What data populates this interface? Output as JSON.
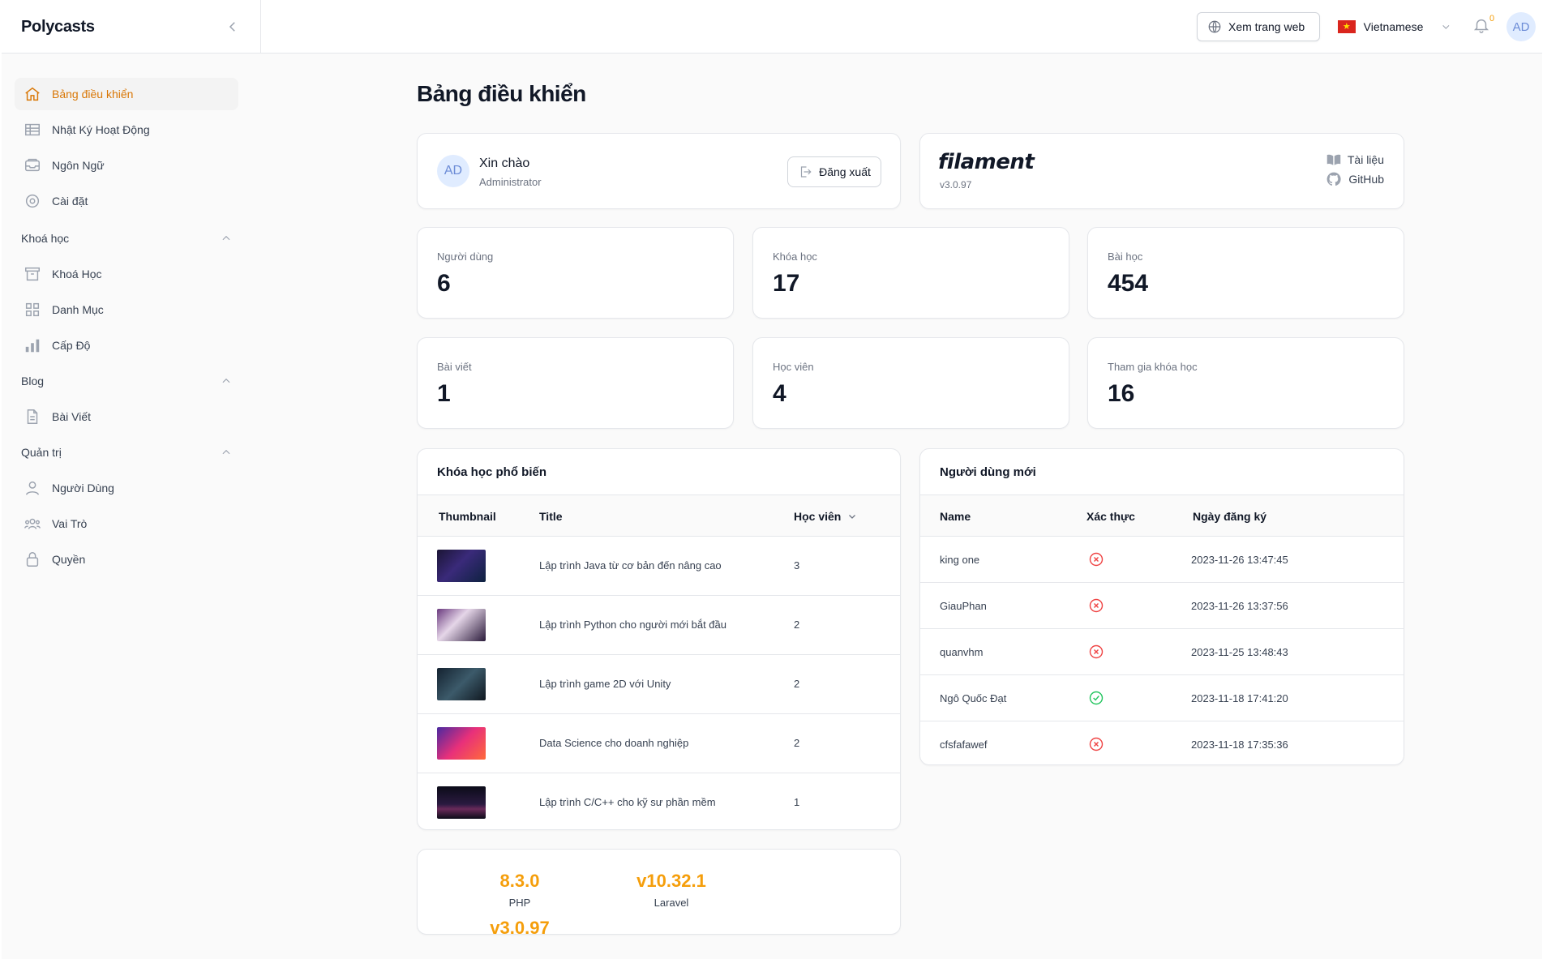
{
  "app": {
    "brand": "Polycasts"
  },
  "topbar": {
    "view_site_label": "Xem trang web",
    "language": "Vietnamese",
    "notification_count": "0",
    "user_initials": "AD"
  },
  "sidebar": {
    "items": [
      {
        "label": "Bảng điều khiển",
        "icon": "home-icon",
        "active": true
      },
      {
        "label": "Nhật Ký Hoạt Động",
        "icon": "table-icon"
      },
      {
        "label": "Ngôn Ngữ",
        "icon": "inbox-icon"
      },
      {
        "label": "Cài đặt",
        "icon": "settings-icon"
      }
    ],
    "groups": [
      {
        "label": "Khoá học",
        "items": [
          {
            "label": "Khoá Học",
            "icon": "archive-icon"
          },
          {
            "label": "Danh Mục",
            "icon": "grid-icon"
          },
          {
            "label": "Cấp Độ",
            "icon": "bar-chart-icon"
          }
        ]
      },
      {
        "label": "Blog",
        "items": [
          {
            "label": "Bài Viết",
            "icon": "document-icon"
          }
        ]
      },
      {
        "label": "Quản trị",
        "items": [
          {
            "label": "Người Dùng",
            "icon": "user-icon"
          },
          {
            "label": "Vai Trò",
            "icon": "users-group-icon"
          },
          {
            "label": "Quyền",
            "icon": "lock-icon"
          }
        ]
      }
    ]
  },
  "main": {
    "title": "Bảng điều khiển",
    "account": {
      "initials": "AD",
      "greeting": "Xin chào",
      "role": "Administrator",
      "logout_label": "Đăng xuất"
    },
    "filament": {
      "logo_text": "filament",
      "version": "v3.0.97",
      "docs_label": "Tài liệu",
      "github_label": "GitHub"
    },
    "stats": [
      {
        "label": "Người dùng",
        "value": "6"
      },
      {
        "label": "Khóa học",
        "value": "17"
      },
      {
        "label": "Bài học",
        "value": "454"
      },
      {
        "label": "Bài viết",
        "value": "1"
      },
      {
        "label": "Học viên",
        "value": "4"
      },
      {
        "label": "Tham gia khóa học",
        "value": "16"
      }
    ],
    "popular_courses": {
      "title": "Khóa học phổ biến",
      "columns": [
        "Thumbnail",
        "Title",
        "Học viên"
      ],
      "rows": [
        {
          "title": "Lập trình Java từ cơ bản đến nâng cao",
          "students": "3",
          "thumb_color": "#2a2350"
        },
        {
          "title": "Lập trình Python cho người mới bắt đầu",
          "students": "2",
          "thumb_color": "#4a2d5e"
        },
        {
          "title": "Lập trình game 2D với Unity",
          "students": "2",
          "thumb_color": "#1f3140"
        },
        {
          "title": "Data Science cho doanh nghiệp",
          "students": "2",
          "thumb_color": "#c2287a"
        },
        {
          "title": "Lập trình C/C++ cho kỹ sư phần mềm",
          "students": "1",
          "thumb_color": "#1a1a2a"
        }
      ]
    },
    "new_users": {
      "title": "Người dùng mới",
      "columns": [
        "Name",
        "Xác thực",
        "Ngày đăng ký"
      ],
      "rows": [
        {
          "name": "king one",
          "verified": false,
          "date": "2023-11-26 13:47:45"
        },
        {
          "name": "GiauPhan",
          "verified": false,
          "date": "2023-11-26 13:37:56"
        },
        {
          "name": "quanvhm",
          "verified": false,
          "date": "2023-11-25 13:48:43"
        },
        {
          "name": "Ngô Quốc Đạt",
          "verified": true,
          "date": "2023-11-18 17:41:20"
        },
        {
          "name": "cfsfafawef",
          "verified": false,
          "date": "2023-11-18 17:35:36"
        }
      ]
    },
    "versions": [
      {
        "value": "8.3.0",
        "label": "PHP"
      },
      {
        "value": "v10.32.1",
        "label": "Laravel"
      },
      {
        "value": "v3.0.97",
        "label": ""
      }
    ]
  },
  "colors": {
    "accent": "#d97706",
    "version_orange": "#f59e0b",
    "error_red": "#ef4444",
    "success_green": "#22c55e"
  }
}
